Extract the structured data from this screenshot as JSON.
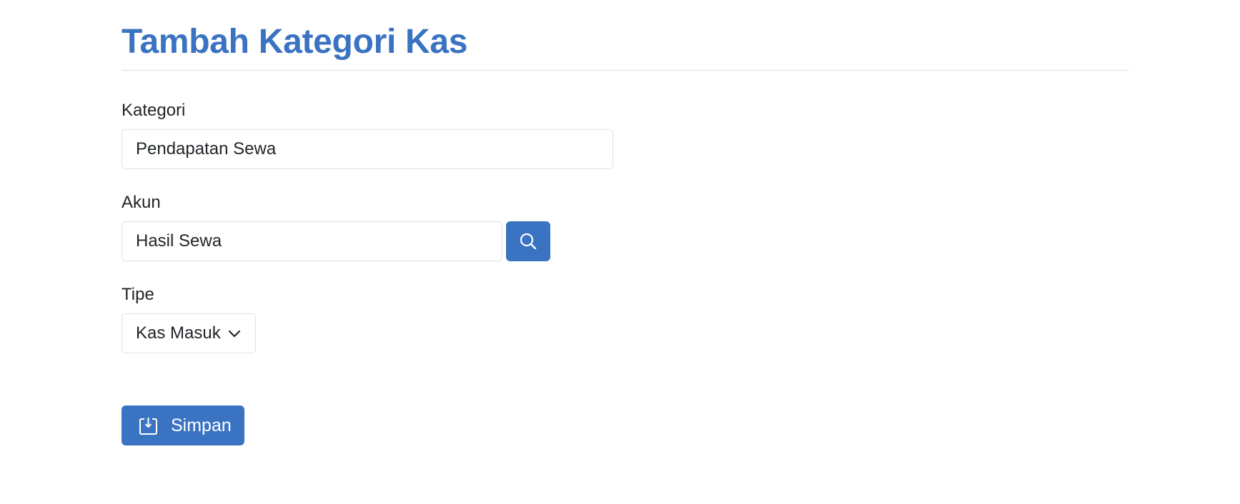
{
  "page": {
    "title": "Tambah Kategori Kas"
  },
  "form": {
    "kategori": {
      "label": "Kategori",
      "value": "Pendapatan Sewa"
    },
    "akun": {
      "label": "Akun",
      "value": "Hasil Sewa",
      "search_icon": "search-icon"
    },
    "tipe": {
      "label": "Tipe",
      "selected": "Kas Masuk",
      "dropdown_icon": "chevron-down-icon"
    },
    "save": {
      "label": "Simpan",
      "icon": "save-download-icon"
    }
  },
  "colors": {
    "accent": "#3a73c2",
    "text": "#212529",
    "border": "#dee2e6"
  }
}
